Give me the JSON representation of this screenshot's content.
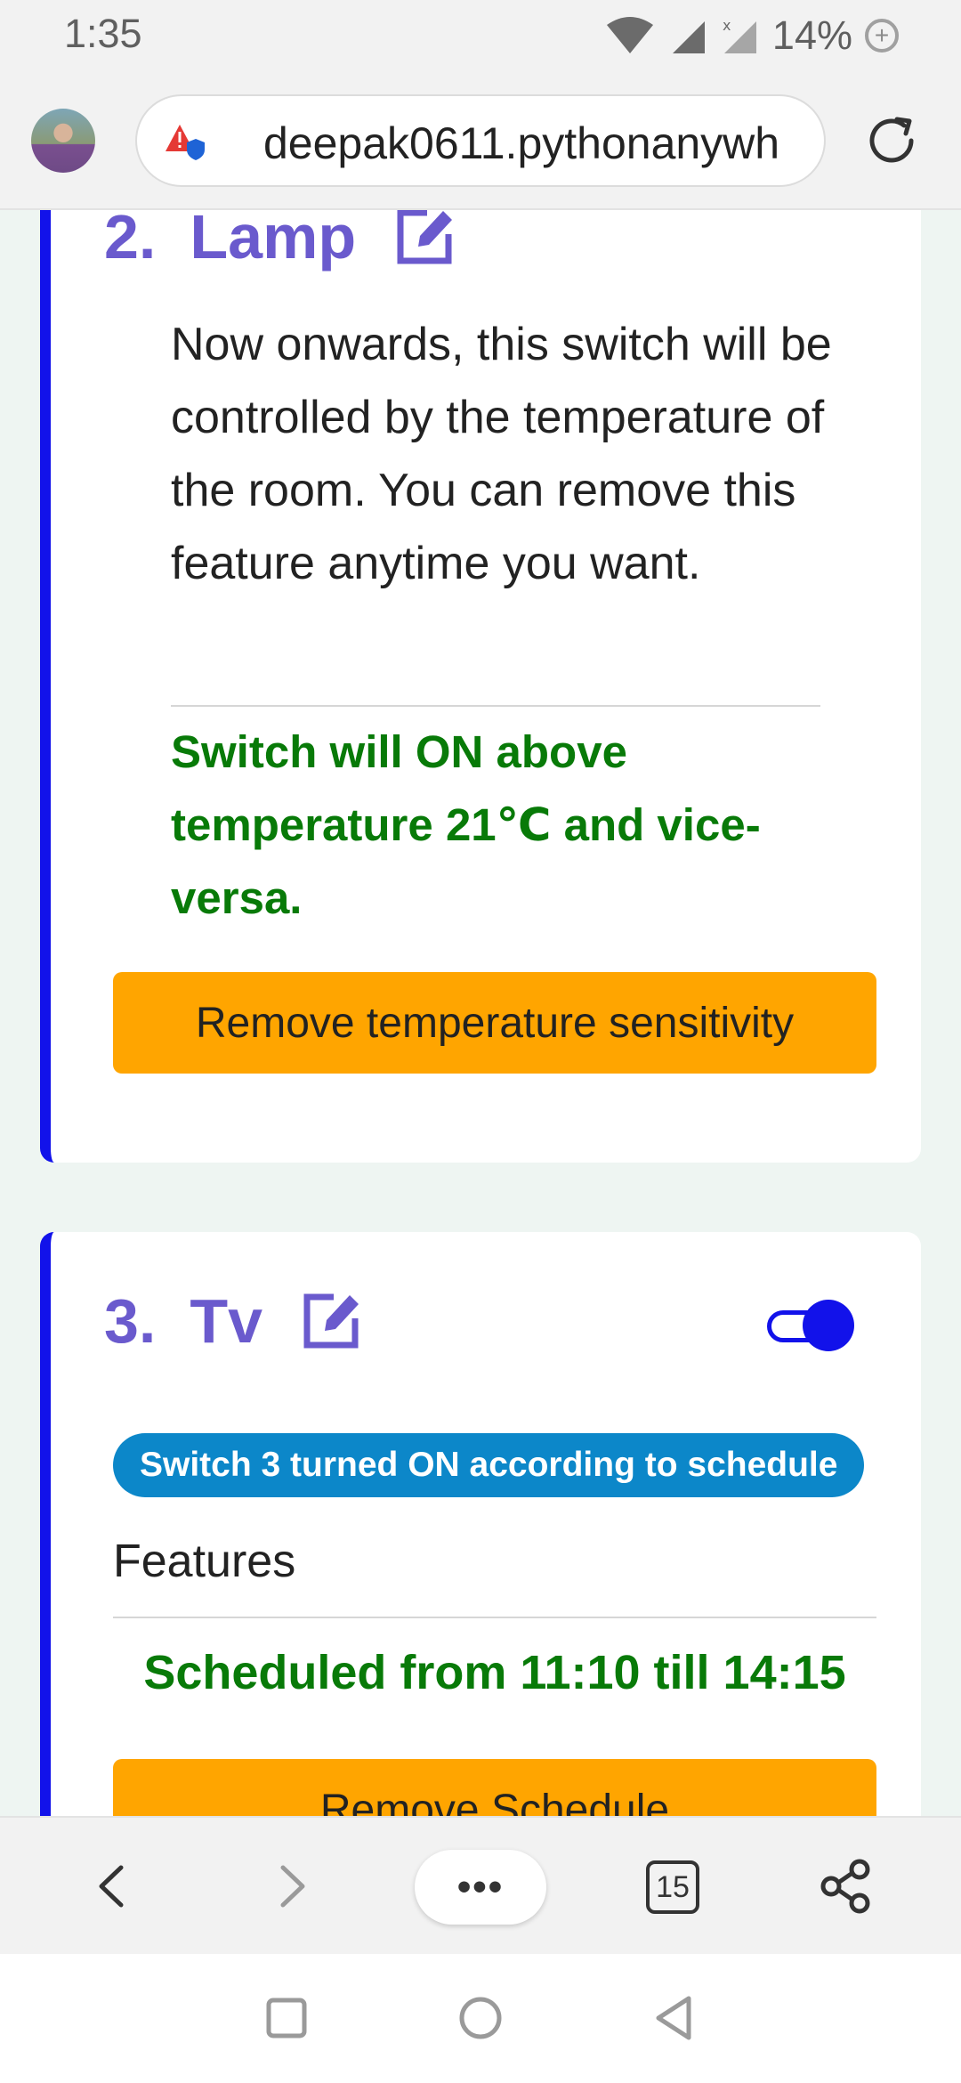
{
  "status_bar": {
    "time": "1:35",
    "battery_percent": "14%",
    "icons": [
      "wifi-icon",
      "signal-icon",
      "signal-x-icon",
      "battery-saver-icon"
    ]
  },
  "browser": {
    "url": "deepak0611.pythonanywh",
    "site_warning_icon": "warning-shield-icon",
    "reload_icon": "reload-icon",
    "tab_count": "15",
    "menu_label": "•••"
  },
  "cards": {
    "lamp": {
      "number": "2.",
      "name": "Lamp",
      "description": "Now onwards, this switch will be controlled by the temperature of the room. You can remove this feature anytime you want.",
      "temperature_rule": "Switch will ON above temperature 21℃ and vice-versa.",
      "button_label": "Remove temperature sensitivity"
    },
    "tv": {
      "number": "3.",
      "name": "Tv",
      "toggle_on": true,
      "status_badge": "Switch 3 turned ON according to schedule",
      "features_label": "Features",
      "schedule_text": "Scheduled from 11:10 till 14:15",
      "button_label": "Remove Schedule"
    }
  },
  "colors": {
    "accent_purple": "#6a5acd",
    "card_border_blue": "#1212ea",
    "success_green": "#087a08",
    "button_orange": "#ffa500",
    "badge_blue": "#0c87c9",
    "page_bg": "#eef5f2"
  }
}
